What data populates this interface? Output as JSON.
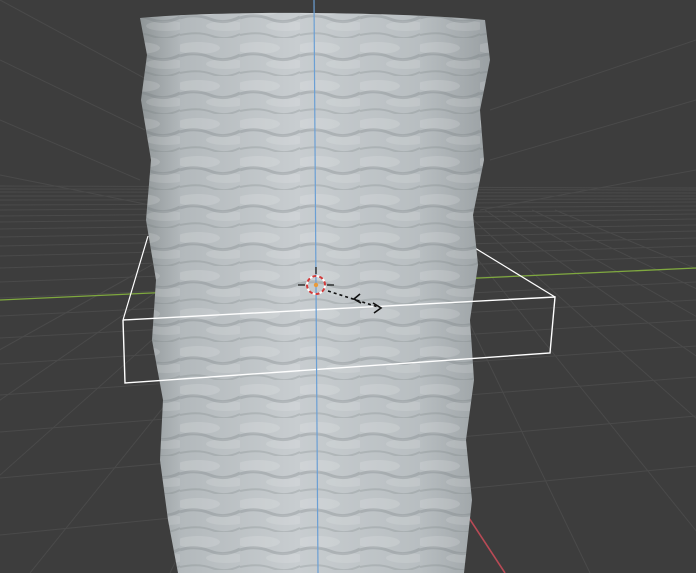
{
  "viewport": {
    "background_color": "#3d3d3d",
    "grid_color": "#4a4a4a",
    "x_axis_color": "#b84a55",
    "y_axis_color": "#7fa83f",
    "z_axis_color": "#6b9fd4",
    "object_color": "#b9bfc2",
    "selection_outline_color": "#ffffff",
    "cursor_icon": "3d-cursor-icon",
    "gizmo_icon": "scale-arrows-icon",
    "object_name": "displaced-cylinder-mesh"
  }
}
